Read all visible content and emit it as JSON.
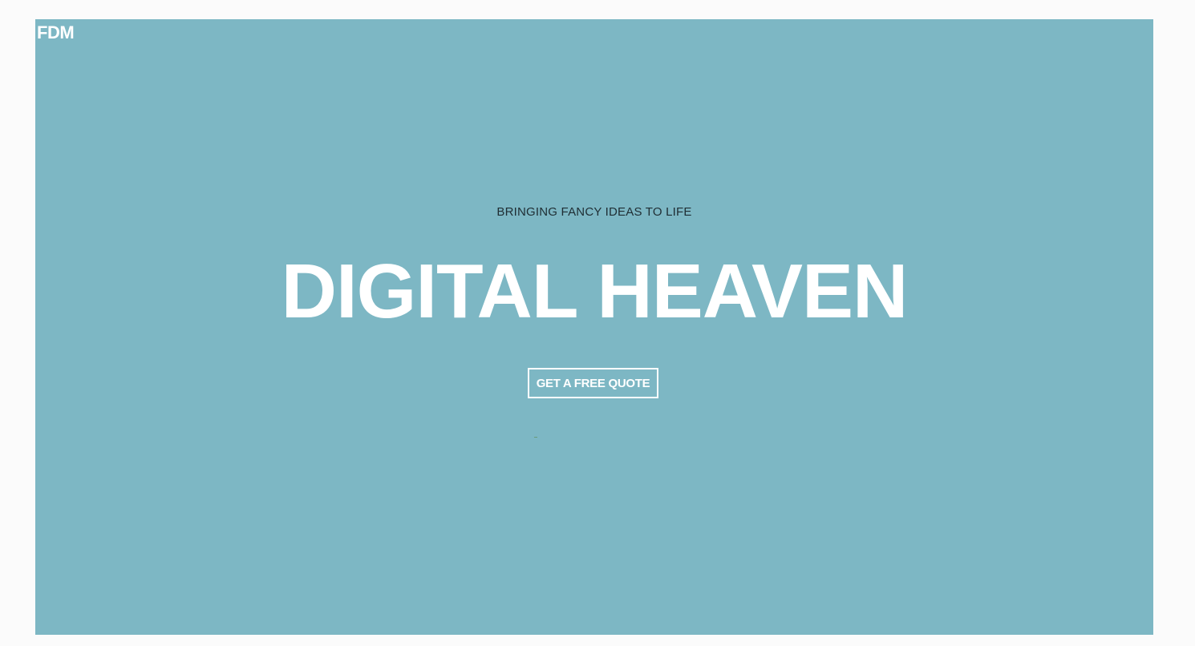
{
  "brand": {
    "logo_text": "FDM"
  },
  "hero": {
    "tagline": "BRINGING FANCY IDEAS TO LIFE",
    "headline": "DIGITAL HEAVEN",
    "cta_label": "GET A FREE QUOTE",
    "background_color": "#7db7c4",
    "text_color": "#ffffff"
  }
}
